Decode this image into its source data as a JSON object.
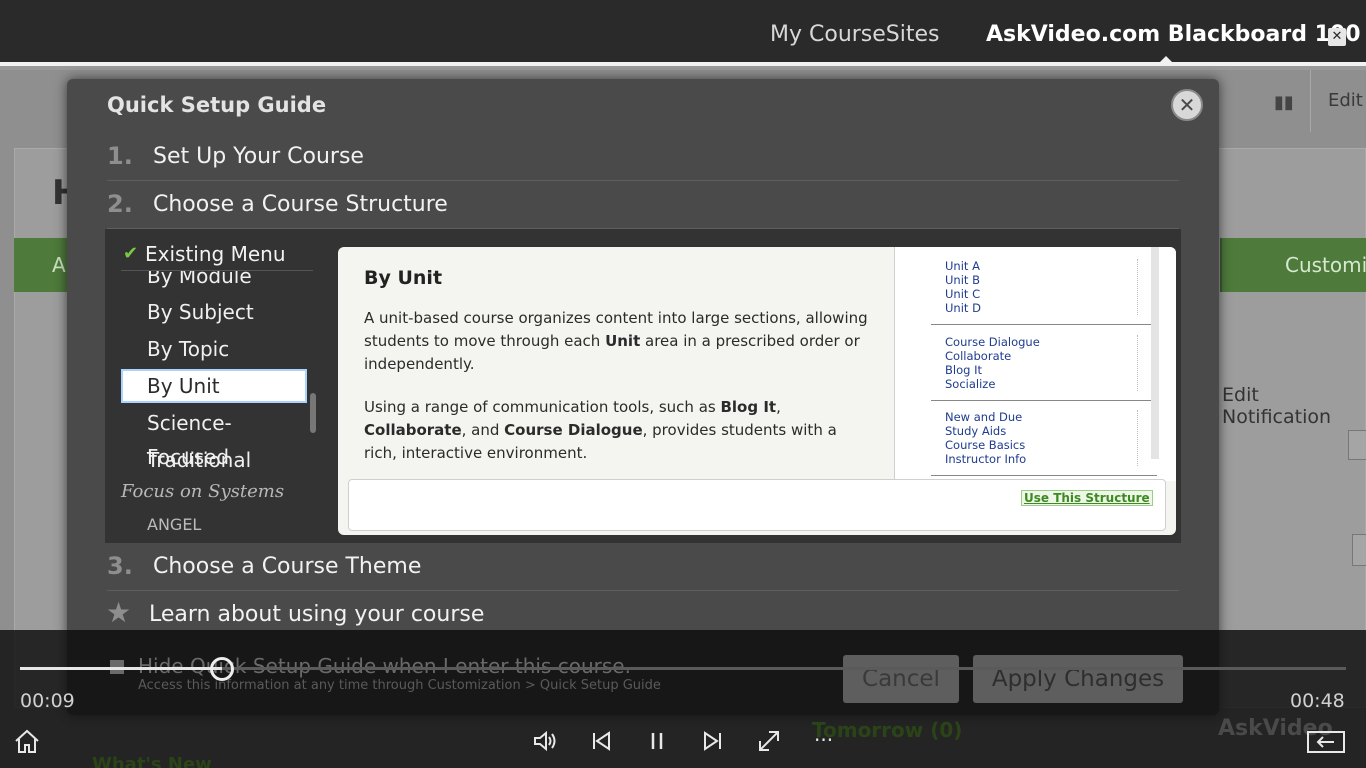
{
  "topbar": {
    "my_coursesites": "My CourseSites",
    "course_title": "AskVideo.com Blackboard 100",
    "close_glyph": "✕"
  },
  "background": {
    "heading_initial": "H",
    "green_left": "A",
    "green_right": "Customi",
    "edit": "Edit",
    "edit_notification": "Edit Notification",
    "tomorrow": "Tomorrow (0)",
    "whats_new": "What's New",
    "watermark": "AskVideo"
  },
  "modal": {
    "title": "Quick Setup Guide",
    "close_glyph": "✕",
    "steps": [
      {
        "num": "1.",
        "label": "Set Up Your Course"
      },
      {
        "num": "2.",
        "label": "Choose a Course Structure"
      },
      {
        "num": "3.",
        "label": "Choose a Course Theme"
      },
      {
        "num": "★",
        "label": "Learn about using your course"
      }
    ],
    "structure_menu": {
      "header": "Existing Menu",
      "items": [
        "By Module",
        "By Subject",
        "By Topic",
        "By Unit",
        "Science-Focused",
        "Traditional"
      ],
      "selected": "By Unit",
      "section": "Focus on Systems",
      "partial_item": "ANGEL"
    },
    "preview": {
      "title": "By Unit",
      "para1_parts": [
        "A unit-based course organizes content into large sections, allowing students to move through each ",
        "Unit",
        " area in a prescribed order or independently."
      ],
      "para2_parts": [
        "Using a range of communication tools, such as ",
        "Blog It",
        ", ",
        "Collaborate",
        ", and ",
        "Course Dialogue",
        ", provides students with a rich, interactive environment."
      ],
      "groups": [
        [
          "Unit A",
          "Unit B",
          "Unit C",
          "Unit D"
        ],
        [
          "Course Dialogue",
          "Collaborate",
          "Blog It",
          "Socialize"
        ],
        [
          "New and Due",
          "Study Aids",
          "Course Basics",
          "Instructor Info"
        ]
      ],
      "use_button": "Use This Structure"
    },
    "hide_label": "Hide Quick Setup Guide when I enter this course.",
    "hide_sub": "Access this information at any time through Customization > Quick Setup Guide",
    "cancel": "Cancel",
    "apply": "Apply Changes"
  },
  "player": {
    "current_time": "00:09",
    "total_time": "00:48",
    "progress_fraction": 0.152,
    "more": "..."
  },
  "icons": [
    "home-icon",
    "volume-icon",
    "previous-icon",
    "pause-icon",
    "next-icon",
    "fullscreen-icon",
    "exit-icon"
  ]
}
